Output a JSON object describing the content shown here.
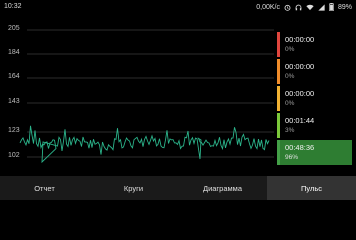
{
  "status_bar": {
    "time": "10:32",
    "speed": "0,00K/c",
    "battery": "89%",
    "icons": [
      "alarm-icon",
      "headphones-icon",
      "wifi-icon",
      "signal-icon",
      "battery-icon"
    ]
  },
  "chart": {
    "y_ticks": [
      "205",
      "184",
      "164",
      "143",
      "123",
      "102"
    ],
    "line_color": "#2bb38a",
    "grid_color": "#3a3a3a"
  },
  "zones": [
    {
      "time": "00:00:00",
      "percent": "0%",
      "color": "#e0463e",
      "active": false
    },
    {
      "time": "00:00:00",
      "percent": "0%",
      "color": "#f08c2a",
      "active": false
    },
    {
      "time": "00:00:00",
      "percent": "0%",
      "color": "#f2b233",
      "active": false
    },
    {
      "time": "00:01:44",
      "percent": "3%",
      "color": "#7cc83a",
      "active": false
    },
    {
      "time": "00:48:36",
      "percent": "96%",
      "color": "#43a047",
      "active": true
    }
  ],
  "tabs": [
    "Отчет",
    "Круги",
    "Диаграмма",
    "Пульс"
  ],
  "active_tab": 3
}
